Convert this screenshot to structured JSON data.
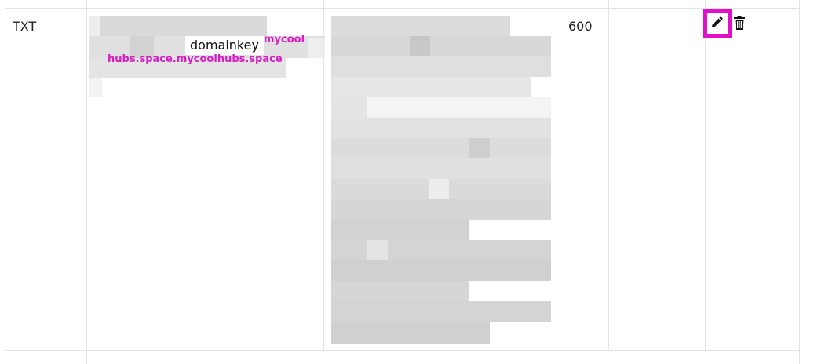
{
  "record": {
    "type": "TXT",
    "name_visible": "domainkey",
    "ttl": "600"
  },
  "annotation": {
    "line1": "mycool",
    "line2": "hubs.space.mycoolhubs.space",
    "color": "#d61fc3"
  },
  "actions": {
    "edit_icon": "pencil-icon",
    "delete_icon": "trash-icon",
    "highlight_color": "#e010c8"
  }
}
